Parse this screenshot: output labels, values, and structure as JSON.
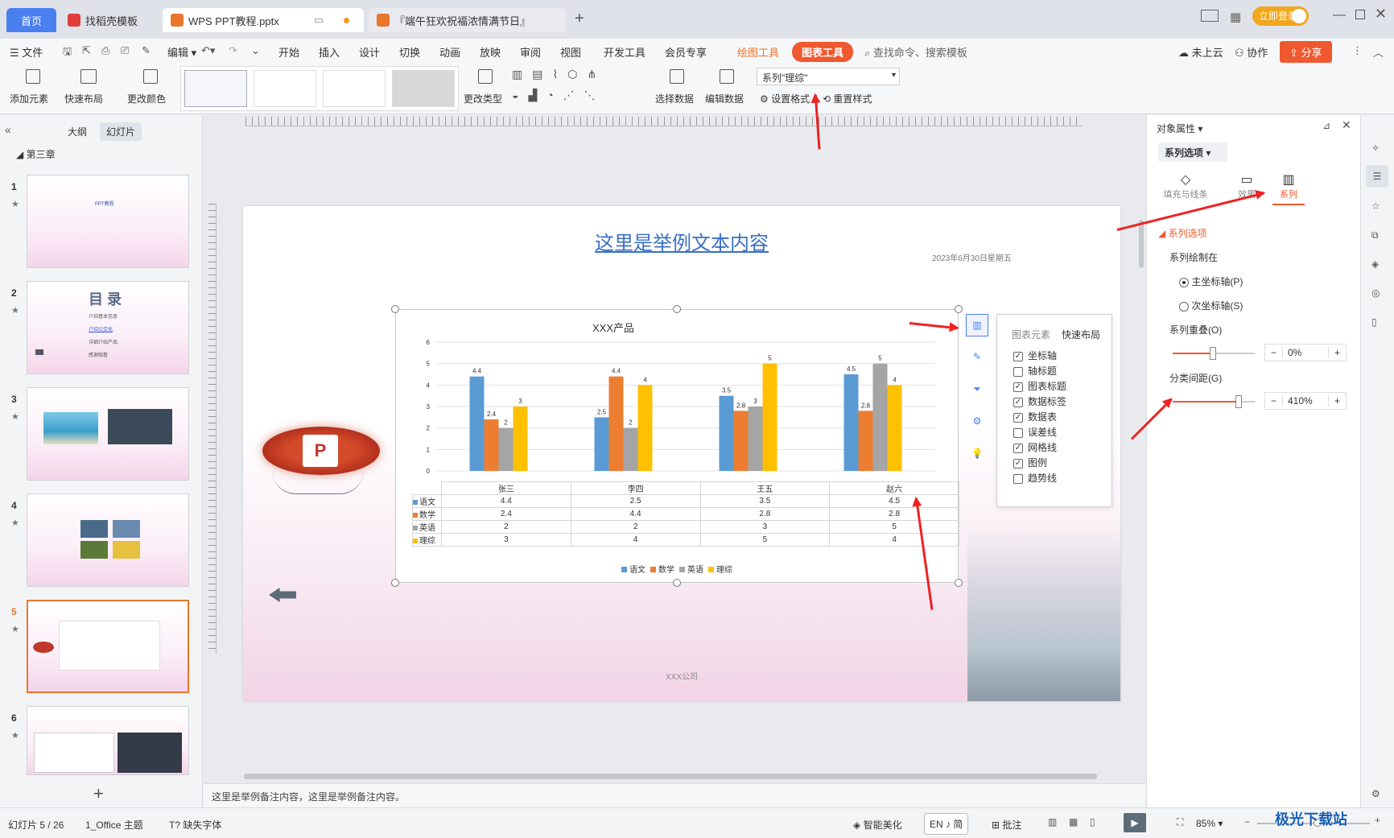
{
  "tabs": [
    {
      "label": "首页"
    },
    {
      "label": "找稻壳模板"
    },
    {
      "label": "WPS PPT教程.pptx"
    },
    {
      "label": "『端午狂欢祝福浓情满节日』"
    }
  ],
  "login_label": "立即登录",
  "menu": {
    "file": "文件",
    "items": [
      "编辑",
      "开始",
      "插入",
      "设计",
      "切换",
      "动画",
      "放映",
      "审阅",
      "视图",
      "开发工具",
      "会员专享"
    ],
    "draw_tools": "绘图工具",
    "chart_tools": "图表工具",
    "search_placeholder": "查找命令、搜索模板",
    "cloud": "未上云",
    "collab": "协作",
    "share": "分享"
  },
  "ribbon": {
    "add_element": "添加元素",
    "quick_layout": "快速布局",
    "change_color": "更改颜色",
    "change_type": "更改类型",
    "select_data": "选择数据",
    "edit_data": "编辑数据",
    "series_select": "系列\"理综\"",
    "set_format": "设置格式",
    "reset_style": "重置样式"
  },
  "left": {
    "outline": "大纲",
    "slides": "幻灯片",
    "chapter": "第三章",
    "slide_numbers": [
      "1",
      "2",
      "3",
      "4",
      "5",
      "6"
    ],
    "s1_title": "PPT教程",
    "s2_title": "目 录",
    "s2_items": [
      "介绍基本信息",
      "介绍公交化",
      "详细介绍产品",
      "感谢观看"
    ]
  },
  "slide": {
    "title": "这里是举例文本内容",
    "date": "2023年6月30日星期五",
    "company": "XXX公司",
    "page": "5"
  },
  "chart_data": {
    "type": "bar",
    "title": "XXX产品",
    "categories": [
      "张三",
      "李四",
      "王五",
      "赵六"
    ],
    "series": [
      {
        "name": "语文",
        "values": [
          4.4,
          2.5,
          3.5,
          4.5
        ],
        "color": "#5b9bd5"
      },
      {
        "name": "数学",
        "values": [
          2.4,
          4.4,
          2.8,
          2.8
        ],
        "color": "#ed7d31"
      },
      {
        "name": "英语",
        "values": [
          2,
          2,
          3,
          5
        ],
        "color": "#a5a5a5"
      },
      {
        "name": "理综",
        "values": [
          3,
          4,
          5,
          4
        ],
        "color": "#ffc000"
      }
    ],
    "ylim": [
      0,
      6
    ],
    "yticks": [
      "0",
      "1",
      "2",
      "3",
      "4",
      "5",
      "6"
    ],
    "grid": true,
    "legend": "bottom"
  },
  "chart_elements": {
    "tab1": "图表元素",
    "tab2": "快速布局",
    "items": [
      {
        "label": "坐标轴",
        "checked": true
      },
      {
        "label": "轴标题",
        "checked": false
      },
      {
        "label": "图表标题",
        "checked": true
      },
      {
        "label": "数据标签",
        "checked": true
      },
      {
        "label": "数据表",
        "checked": true
      },
      {
        "label": "误差线",
        "checked": false
      },
      {
        "label": "网格线",
        "checked": true
      },
      {
        "label": "图例",
        "checked": true
      },
      {
        "label": "趋势线",
        "checked": false
      }
    ]
  },
  "panel": {
    "title": "对象属性",
    "dropdown": "系列选项",
    "tab_fill": "填充与线条",
    "tab_effect": "效果",
    "tab_series": "系列",
    "section": "系列选项",
    "plot_on": "系列绘制在",
    "primary_axis": "主坐标轴(P)",
    "secondary_axis": "次坐标轴(S)",
    "overlap_label": "系列重叠(O)",
    "overlap_value": "0%",
    "gap_label": "分类间距(G)",
    "gap_value": "410%"
  },
  "notes": "这里是举例备注内容，这里是举例备注内容。",
  "status": {
    "slide_info": "幻灯片 5 / 26",
    "theme": "1_Office 主题",
    "missing_font": "缺失字体",
    "beautify": "智能美化",
    "lang": "EN ♪ 简",
    "comment": "批注",
    "zoom": "85%"
  },
  "watermark": "极光下载站"
}
